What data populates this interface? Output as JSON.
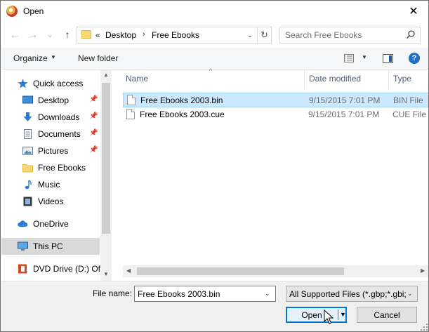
{
  "window": {
    "title": "Open",
    "close_glyph": "✕"
  },
  "nav_buttons": {
    "back": "←",
    "forward": "→",
    "recent": "⌄",
    "up": "↑"
  },
  "address": {
    "chevron": "«",
    "crumbs": [
      "Desktop",
      "Free Ebooks"
    ],
    "separator": "›",
    "dropdown_glyph": "⌄",
    "refresh_glyph": "↻"
  },
  "search": {
    "placeholder": "Search Free Ebooks"
  },
  "toolbar": {
    "organize_label": "Organize",
    "dropdown_glyph": "▼",
    "new_folder_label": "New folder",
    "help_glyph": "?"
  },
  "sidebar": {
    "items": [
      {
        "label": "Quick access",
        "icon": "star-icon",
        "pinned": false
      },
      {
        "label": "Desktop",
        "icon": "desktop-icon",
        "pinned": true
      },
      {
        "label": "Downloads",
        "icon": "download-icon",
        "pinned": true
      },
      {
        "label": "Documents",
        "icon": "documents-icon",
        "pinned": true
      },
      {
        "label": "Pictures",
        "icon": "pictures-icon",
        "pinned": true
      },
      {
        "label": "Free Ebooks",
        "icon": "folder-icon",
        "pinned": false
      },
      {
        "label": "Music",
        "icon": "music-icon",
        "pinned": false
      },
      {
        "label": "Videos",
        "icon": "videos-icon",
        "pinned": false
      },
      {
        "label": "OneDrive",
        "icon": "cloud-icon",
        "pinned": false
      },
      {
        "label": "This PC",
        "icon": "computer-icon",
        "pinned": false
      },
      {
        "label": "DVD Drive (D:) Off",
        "icon": "office-icon",
        "pinned": false
      }
    ],
    "pin_glyph": "📌"
  },
  "file_list": {
    "columns": [
      "Name",
      "Date modified",
      "Type"
    ],
    "sort_glyph": "^",
    "rows": [
      {
        "name": "Free Ebooks 2003.bin",
        "date": "9/15/2015 7:01 PM",
        "type": "BIN File",
        "selected": true
      },
      {
        "name": "Free Ebooks 2003.cue",
        "date": "9/15/2015 7:01 PM",
        "type": "CUE File",
        "selected": false
      }
    ]
  },
  "scroll_glyphs": {
    "up": "▲",
    "down": "▼",
    "left": "◀",
    "right": "▶"
  },
  "footer": {
    "file_name_label": "File name:",
    "file_name_value": "Free Ebooks 2003.bin",
    "filter_value": "All Supported Files (*.gbp;*.gbi;",
    "open_label": "Open",
    "cancel_label": "Cancel",
    "dropdown_glyph": "⌄"
  },
  "colors": {
    "selection_fill": "#cce8ff",
    "selection_border": "#99d1ff",
    "accent": "#0078d7",
    "header_text": "#4c607a"
  }
}
